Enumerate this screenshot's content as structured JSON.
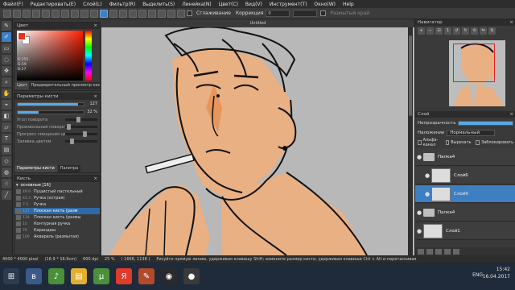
{
  "menu": [
    "Файл(F)",
    "Редактировать(E)",
    "Слой(L)",
    "Фильтр(R)",
    "Выделить(S)",
    "Линейка(N)",
    "Цвет(C)",
    "Вид(V)",
    "Инструмент(T)",
    "Окно(W)",
    "Help"
  ],
  "options": {
    "antialias_label": "Сглаживание",
    "correction_label": "Коррекция",
    "correction_value": "0",
    "mode_value": "",
    "extra_label": "Размытый край"
  },
  "color_panel": {
    "title": "Цвет",
    "r": "R:255",
    "g": "G:59",
    "b": "B:27",
    "tab_color": "Цвет",
    "tab_preview": "Предварительный просмотр кисти",
    "fg_color": "#e8341c",
    "bg_color": "#ffffff"
  },
  "brush_params": {
    "title": "Параметры кисти",
    "size_value": "127",
    "size_fraction": 0.92,
    "opacity_value": "32 %",
    "opacity_fraction": 0.32,
    "rows": [
      {
        "label": "Угол поворота",
        "level": 0.4
      },
      {
        "label": "Произвольный поворот",
        "level": 0.1
      },
      {
        "label": "Прогресс смещения цветов",
        "level": 0.6
      },
      {
        "label": "Заливка цветом",
        "level": 0.2
      }
    ],
    "tab_params": "Параметры кисти",
    "tab_palette": "Палитра"
  },
  "brush_panel": {
    "title": "Кисть",
    "group": "основные [16]",
    "items": [
      {
        "num": "49.9",
        "name": "Пушистый пастельный"
      },
      {
        "num": "43.3",
        "name": "Ручка (острая)"
      },
      {
        "num": "7.5",
        "name": "Ручка"
      },
      {
        "num": "127",
        "name": "Плоская кисть (разм"
      },
      {
        "num": "118",
        "name": "Плоская кисть (размы"
      },
      {
        "num": "10",
        "name": "Контурная ручка"
      },
      {
        "num": "70",
        "name": "Карандаш"
      },
      {
        "num": "100",
        "name": "Акварель (размытая)"
      }
    ],
    "selected_index": 3
  },
  "canvas": {
    "title": "Untitled"
  },
  "navigator": {
    "title": "Навигатор"
  },
  "layers": {
    "title": "Слой",
    "opacity_label": "Непрозрачность",
    "blend_label": "Наложение",
    "blend_value": "Нормальный",
    "alpha_label": "Альфа-канал",
    "clip_label": "Вырезать",
    "lock_label": "Заблокировать",
    "items": [
      {
        "name": "Папка4",
        "kind": "folder"
      },
      {
        "name": "Слой6",
        "kind": "layer"
      },
      {
        "name": "Слой9",
        "kind": "layer",
        "selected": true
      },
      {
        "name": "Папка4",
        "kind": "folder"
      },
      {
        "name": "Слой1",
        "kind": "layer"
      }
    ]
  },
  "status": {
    "size": "4000 * 4000 pixel",
    "dims": "(16.9 * 16.9cm)",
    "dpi": "600 dpi",
    "zoom": "25 %",
    "coords": "( 1666, 1138 )",
    "hint": "Рисуйте прямую линию, удерживая клавишу Shift; измените размер кисти, удерживая клавиши Ctrl + Alt и перетаскивая"
  },
  "taskbar": {
    "lang": "ENG",
    "time": "15:42",
    "date": "16.04.2017"
  }
}
